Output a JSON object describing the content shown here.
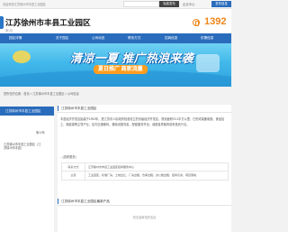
{
  "topbar": {
    "text": "欢迎来到江苏徐州市丰县工业园区",
    "search_label": "全部",
    "search_button": "免费发布",
    "button2": "企业中心",
    "post_button": "发布信息"
  },
  "header": {
    "title": "江苏徐州市丰县工业园区",
    "subtitle": "第1页",
    "phone": "1392"
  },
  "nav": {
    "items": [
      "园区详情",
      "关于园区",
      "公司动态",
      "联系方式",
      "招商信息",
      "供需信息"
    ]
  },
  "banner": {
    "headline": "清凉一夏 推广热浪来袭",
    "badge": "夏日推广 商家流量"
  },
  "breadcrumb": "您所在的位置：首页 > 江苏徐州市丰县工业园区 > 公司信息",
  "sidebar": {
    "header": "江苏徐州市丰县工业园区",
    "rank": "第10年",
    "company": "江苏徐州市丰县工业园区（江苏徐州市丰县）"
  },
  "intro": {
    "title": "江苏徐州市丰县工业园区",
    "paragraph": "丰县经济开发区始建于1992年，是江苏省人民政府批准设立的省级经济开发区，规划面积20.3平方公里，已形成装备制造、食品加工、新能源等主导产业，区内交通便利，基础设施完善，配套服务齐全，诚邀各界客商前来投资兴业。",
    "more": "...(查看更多)"
  },
  "info": {
    "rows": [
      {
        "key": "联系方式",
        "value": "江苏徐州市丰县工业园区招商服务中心"
      },
      {
        "key": "主营",
        "value": "工业园区，标准厂房，土地出让，厂房出租，仓库出租，办公楼出租，招商引资，项目落地"
      }
    ]
  },
  "news": {
    "title": "江苏徐州市丰县工业园区最新产品",
    "empty_text": "暂无最新相关信息"
  },
  "colors": {
    "primary": "#2a6cbc",
    "accent": "#f08519"
  }
}
